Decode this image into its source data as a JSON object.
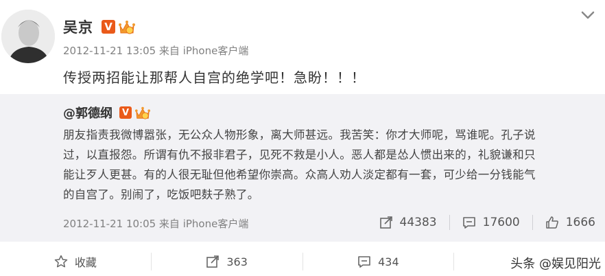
{
  "post": {
    "author": "吴京",
    "verified_badge": "V",
    "meta": "2012-11-21 13:05 来自 iPhone客户端",
    "text": "传授两招能让那帮人自宫的绝学吧！急盼！！！"
  },
  "repost": {
    "author": "@郭德纲",
    "verified_badge": "V",
    "text_lines": [
      "朋友指责我微博嚣张，无公众人物形象，离大师甚远。我苦笑：你才大师呢，骂谁呢。孔子说",
      "过，以直报怨。所谓有仇不报非君子，见死不救是小人。恶人都是怂人惯出来的，礼貌谦和只",
      "能让歹人更甚。有的人很无耻但他希望你崇高。众高人劝人淡定都有一套，可少给一分钱能气",
      "的自宫了。别闹了，吃饭吧麸子熟了。"
    ],
    "meta": "2012-11-21 10:05 来自 iPhone客户端",
    "stats": {
      "reposts": "44383",
      "comments": "17600",
      "likes": "1666"
    }
  },
  "actions": {
    "favorite": "收藏",
    "repost": "363",
    "comment": "434"
  },
  "watermark": "头条 @娱见阳光",
  "colors": {
    "badge": "#ea5a1a",
    "repost_bg": "#f2f2f5",
    "meta": "#808080"
  },
  "icons": [
    "chevron-down-icon",
    "crown-icon",
    "share-icon",
    "comment-icon",
    "thumbs-up-icon",
    "star-icon"
  ]
}
